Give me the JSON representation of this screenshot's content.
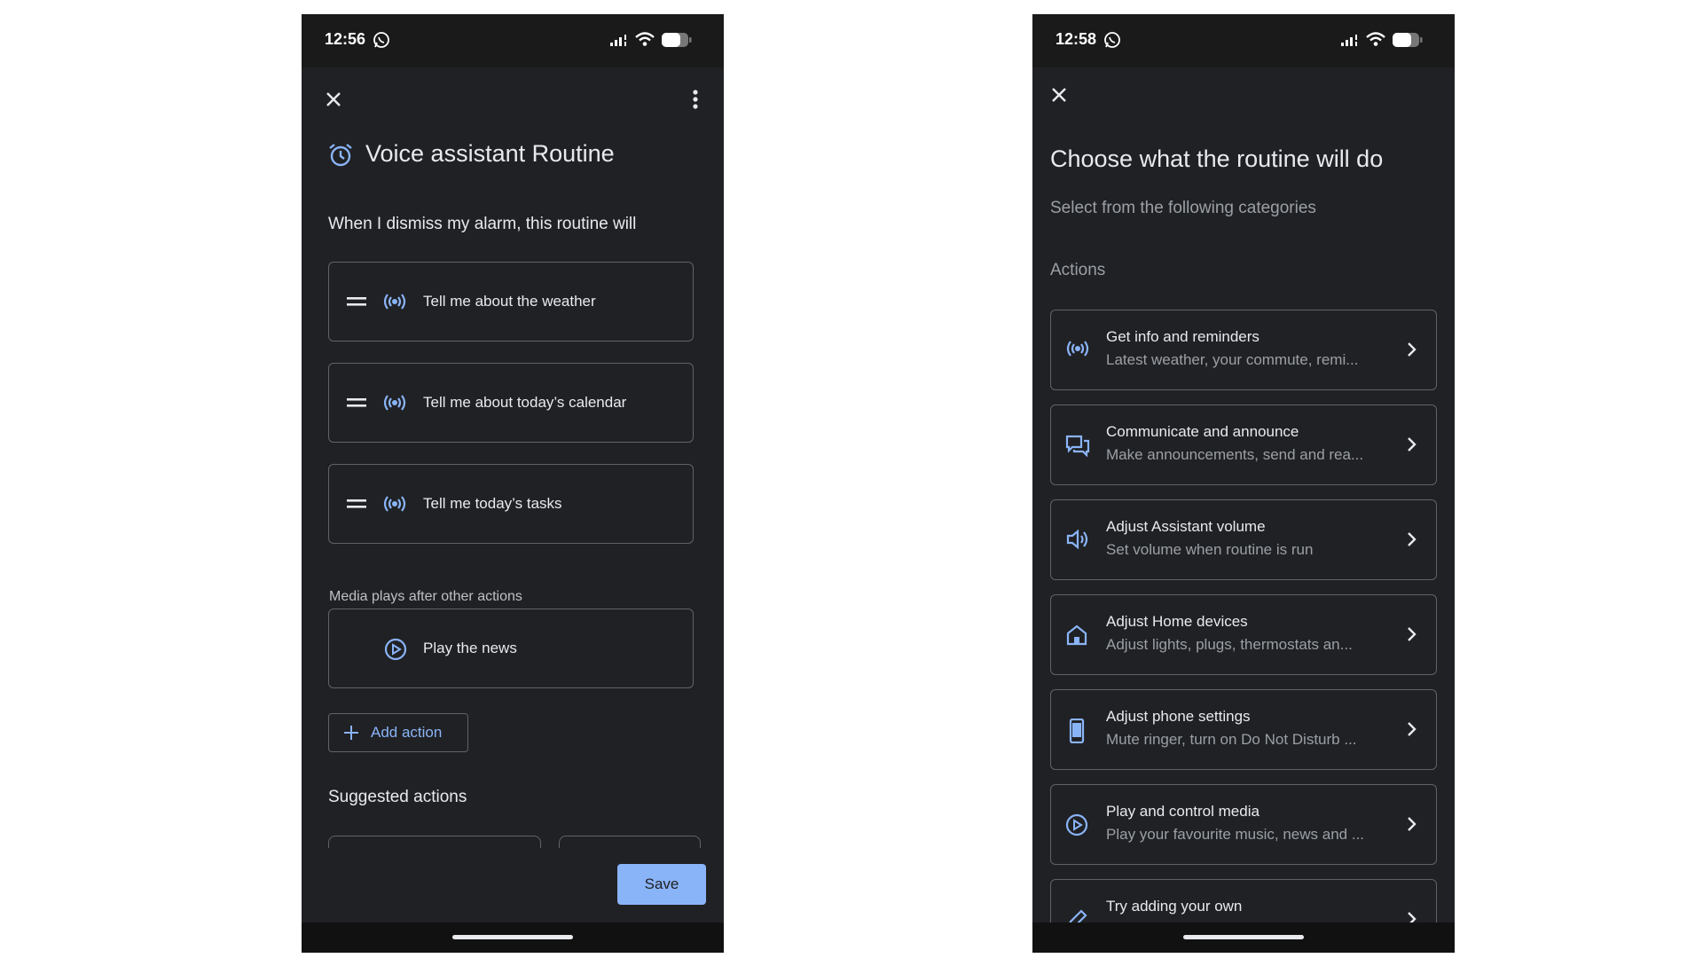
{
  "left_screen": {
    "status": {
      "time": "12:56"
    },
    "title": "Voice assistant Routine",
    "subtitle": "When I dismiss my alarm, this routine will",
    "actions": [
      {
        "label": "Tell me about the weather",
        "icon": "broadcast-icon"
      },
      {
        "label": "Tell me about today’s calendar",
        "icon": "broadcast-icon"
      },
      {
        "label": "Tell me today’s tasks",
        "icon": "broadcast-icon"
      }
    ],
    "media_note": "Media plays after other actions",
    "media_action": {
      "label": "Play the news",
      "icon": "play-circle-icon"
    },
    "add_action_label": "Add action",
    "suggested_label": "Suggested actions",
    "save_label": "Save"
  },
  "right_screen": {
    "status": {
      "time": "12:58"
    },
    "title": "Choose what the routine will do",
    "subtitle": "Select from the following categories",
    "section_label": "Actions",
    "categories": [
      {
        "title": "Get info and reminders",
        "desc": "Latest weather, your commute, remi...",
        "icon": "broadcast-icon"
      },
      {
        "title": "Communicate and announce",
        "desc": "Make announcements, send and rea...",
        "icon": "chat-icon"
      },
      {
        "title": "Adjust Assistant volume",
        "desc": "Set volume when routine is run",
        "icon": "volume-icon"
      },
      {
        "title": "Adjust Home devices",
        "desc": "Adjust lights, plugs, thermostats an...",
        "icon": "home-icon"
      },
      {
        "title": "Adjust phone settings",
        "desc": "Mute ringer, turn on Do Not Disturb ...",
        "icon": "phone-icon"
      },
      {
        "title": "Play and control media",
        "desc": "Play your favourite music, news and ...",
        "icon": "play-circle-icon"
      },
      {
        "title": "Try adding your own",
        "desc": "",
        "icon": "pencil-icon"
      }
    ]
  },
  "colors": {
    "background": "#202124",
    "accent": "#8ab4f8",
    "text": "#e8eaed",
    "secondary_text": "#9aa0a6",
    "border": "#5f6368"
  }
}
